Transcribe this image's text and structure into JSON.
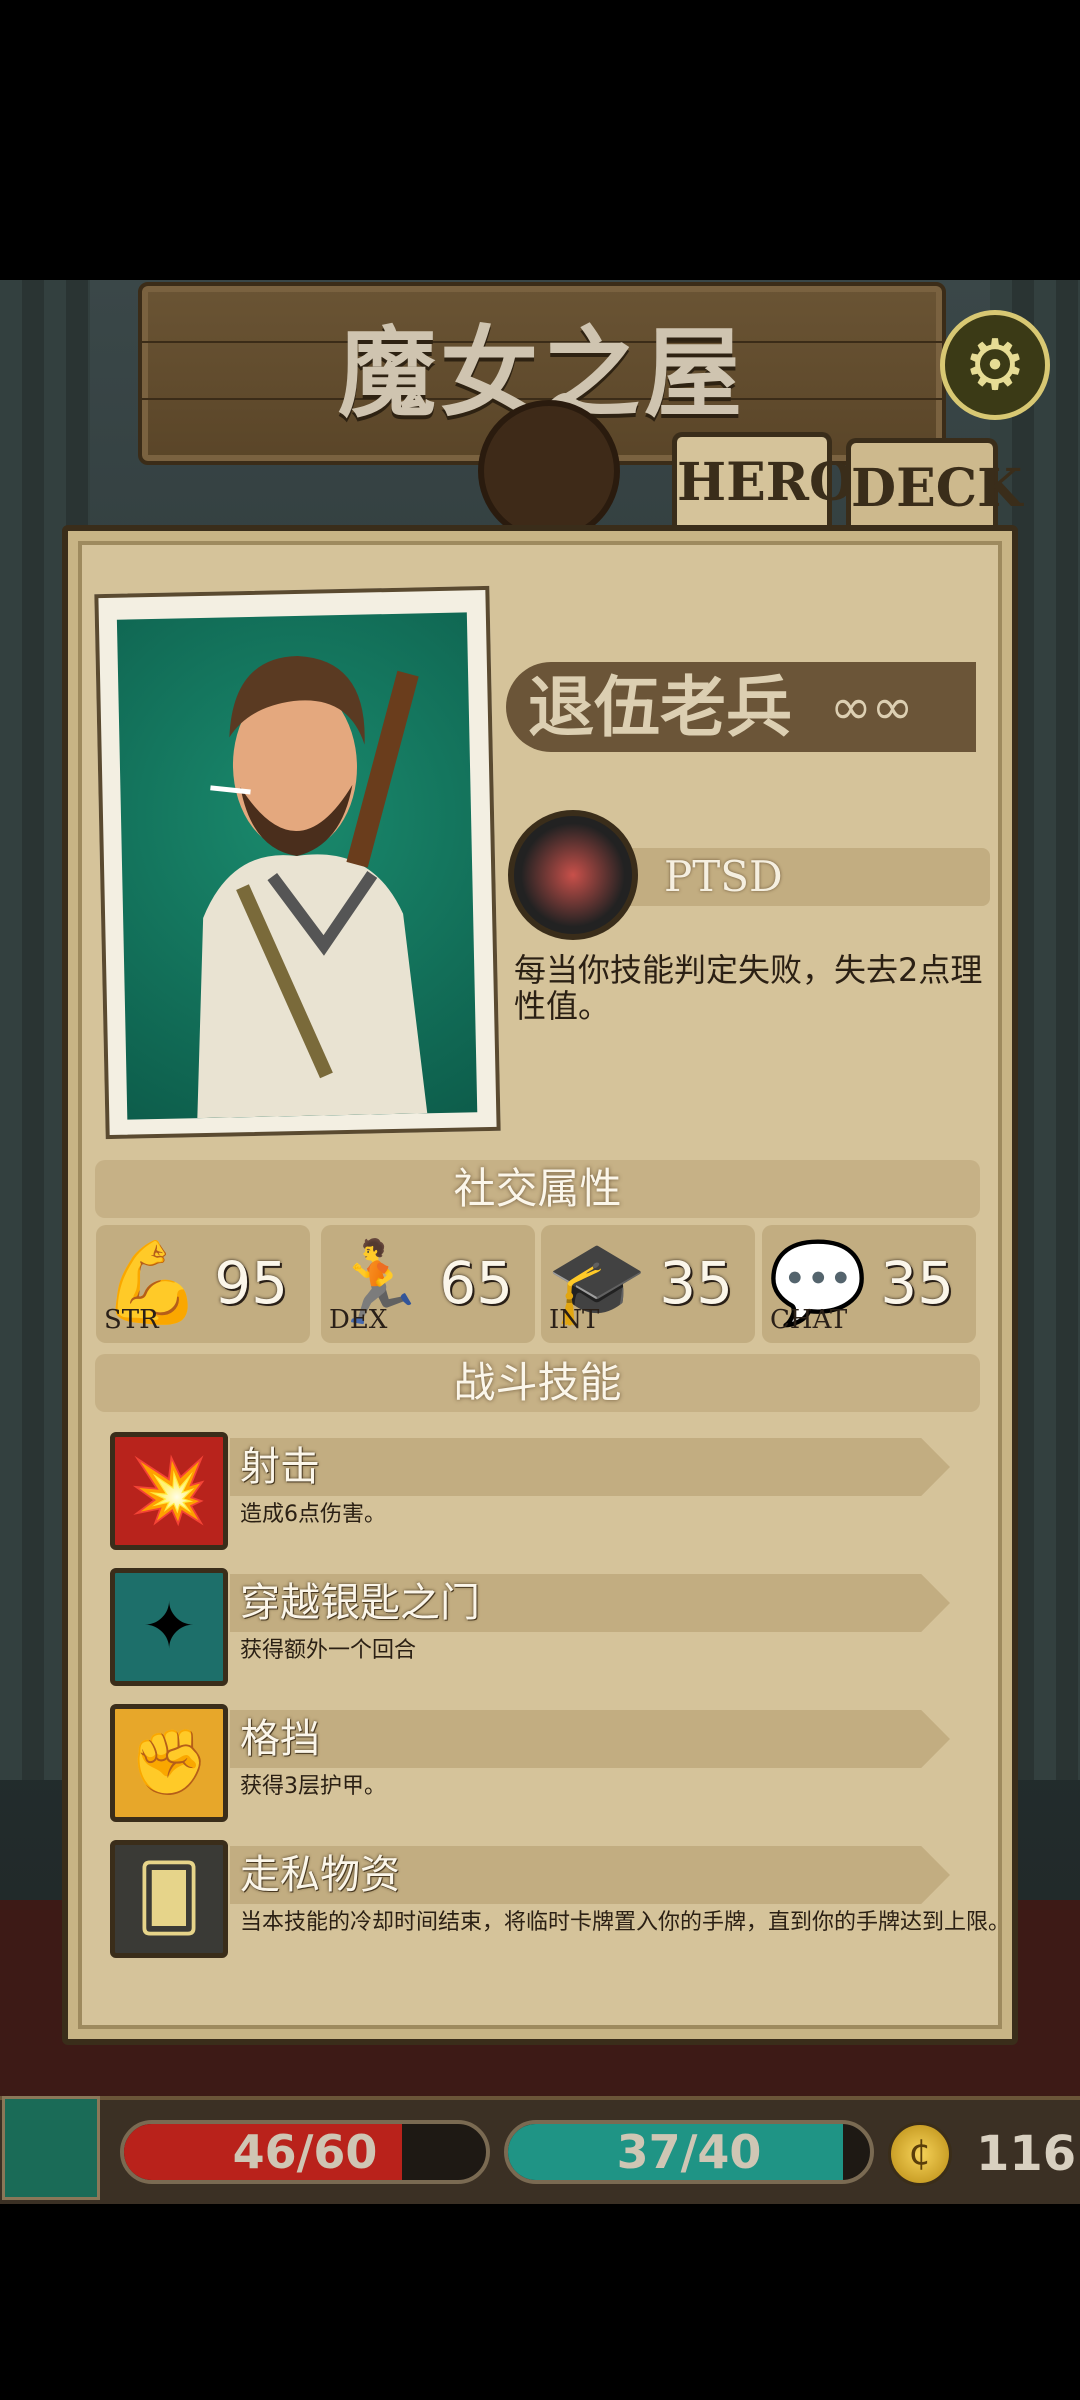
{
  "location_title": "魔女之屋",
  "tabs": [
    {
      "label": "HERO",
      "active": true
    },
    {
      "label": "DECK",
      "active": false
    }
  ],
  "hero": {
    "class_name": "退伍老兵",
    "trait": {
      "name": "PTSD",
      "description": "每当你技能判定失败，失去2点理性值。"
    }
  },
  "social_section_title": "社交属性",
  "stats": [
    {
      "label": "STR",
      "value": "95",
      "icon": "strength-icon"
    },
    {
      "label": "DEX",
      "value": "65",
      "icon": "dexterity-icon"
    },
    {
      "label": "INT",
      "value": "35",
      "icon": "intelligence-icon"
    },
    {
      "label": "CHAT",
      "value": "35",
      "icon": "chat-icon"
    }
  ],
  "combat_section_title": "战斗技能",
  "skills": [
    {
      "name": "射击",
      "description": "造成6点伤害。",
      "icon": "gunshot-icon",
      "color": "#b8231c"
    },
    {
      "name": "穿越银匙之门",
      "description": "获得额外一个回合",
      "icon": "portal-card-icon",
      "color": "#1d6f6a"
    },
    {
      "name": "格挡",
      "description": "获得3层护甲。",
      "icon": "block-arms-icon",
      "color": "#e7a72a"
    },
    {
      "name": "走私物资",
      "description": "当本技能的冷却时间结束，将临时卡牌置入你的手牌，直到你的手牌达到上限。",
      "icon": "cards-fan-icon",
      "color": "#3a3a36"
    }
  ],
  "hud": {
    "hp": {
      "current": 46,
      "max": 60,
      "text": "46/60",
      "color": "#b9221b"
    },
    "sanity": {
      "current": 37,
      "max": 40,
      "text": "37/40",
      "color": "#1f9485"
    },
    "gold": "116"
  }
}
